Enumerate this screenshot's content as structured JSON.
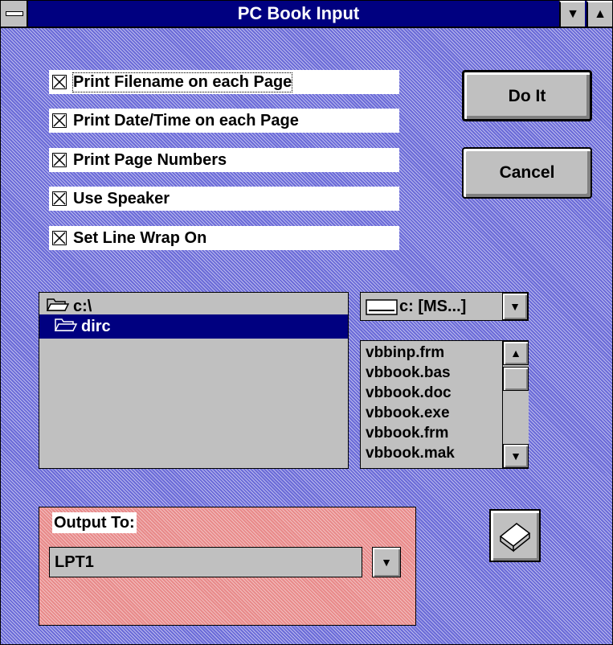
{
  "window": {
    "title": "PC Book Input"
  },
  "options": [
    {
      "label": "Print Filename on each Page",
      "checked": true
    },
    {
      "label": "Print Date/Time on each Page",
      "checked": true
    },
    {
      "label": "Print Page Numbers",
      "checked": true
    },
    {
      "label": "Use Speaker",
      "checked": true
    },
    {
      "label": "Set Line Wrap On",
      "checked": true
    }
  ],
  "buttons": {
    "do_it": "Do It",
    "cancel": "Cancel"
  },
  "directories": [
    {
      "label": "c:\\",
      "icon": "open-folder-icon",
      "selected": false
    },
    {
      "label": "dirc",
      "icon": "open-folder-icon",
      "selected": true
    }
  ],
  "drive": {
    "label": "c: [MS...]",
    "icon": "drive-icon"
  },
  "files": [
    "vbbinp.frm",
    "vbbook.bas",
    "vbbook.doc",
    "vbbook.exe",
    "vbbook.frm",
    "vbbook.mak"
  ],
  "output": {
    "label": "Output To:",
    "value": "LPT1"
  },
  "icons": {
    "print": "book-icon"
  },
  "colors": {
    "titlebar": "#000080",
    "background": "#6a6ad8",
    "group": "#e88a8a",
    "selection": "#000080"
  }
}
